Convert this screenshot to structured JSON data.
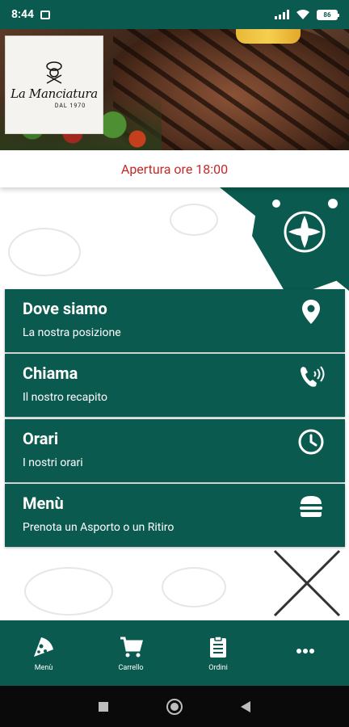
{
  "status_bar": {
    "time": "8:44",
    "battery": "86"
  },
  "header": {
    "logo_text": "La Manciatura",
    "logo_since": "DAL 1970",
    "opening_text": "Apertura ore 18:00"
  },
  "cards": [
    {
      "title": "Dove siamo",
      "subtitle": "La nostra posizione",
      "icon": "location-pin-icon"
    },
    {
      "title": "Chiama",
      "subtitle": "Il nostro recapito",
      "icon": "phone-ringing-icon"
    },
    {
      "title": "Orari",
      "subtitle": "I nostri orari",
      "icon": "clock-icon"
    },
    {
      "title": "Menù",
      "subtitle": "Prenota un Asporto o un Ritiro",
      "icon": "burger-icon"
    }
  ],
  "bottom_nav": [
    {
      "label": "Menù",
      "icon": "pizza-slice-icon"
    },
    {
      "label": "Carrello",
      "icon": "cart-icon"
    },
    {
      "label": "Ordini",
      "icon": "clipboard-icon"
    },
    {
      "label": "",
      "icon": "more-icon"
    }
  ],
  "colors": {
    "primary": "#0b5a4f",
    "accent_red": "#c62828"
  }
}
